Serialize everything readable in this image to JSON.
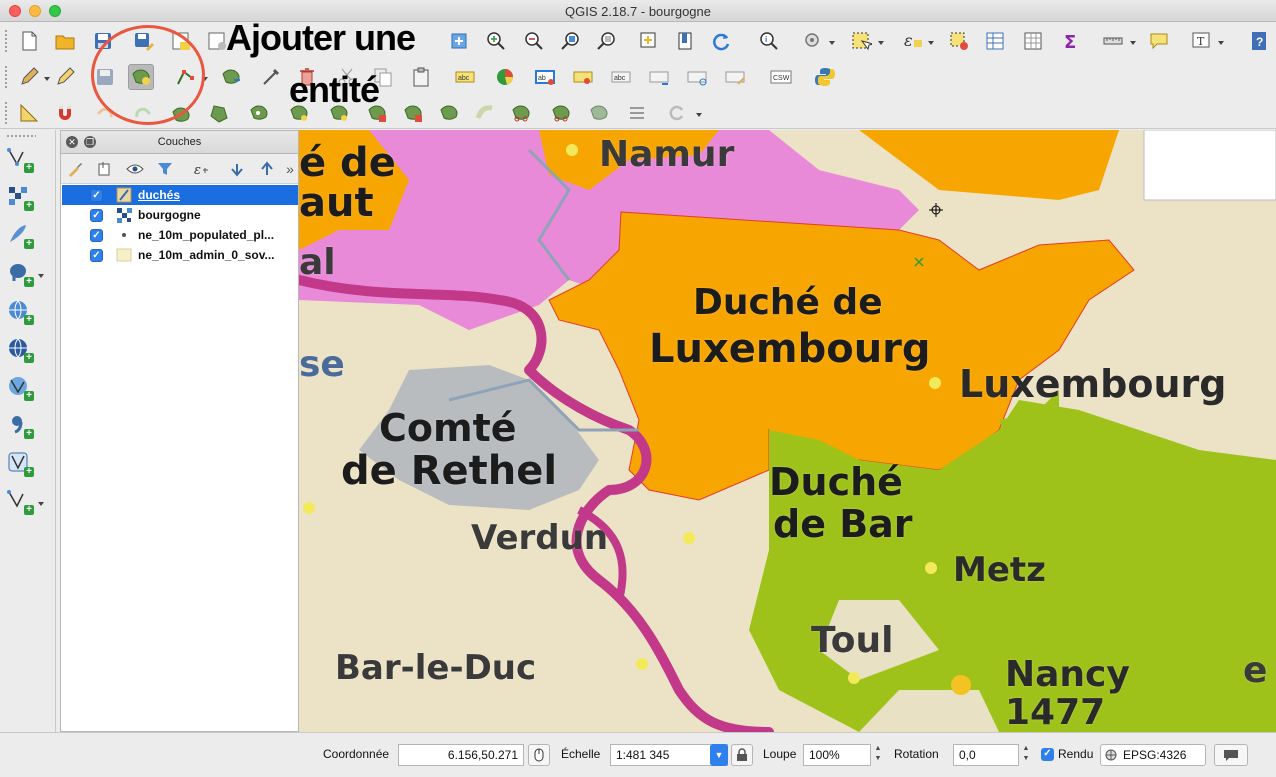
{
  "window": {
    "title": "QGIS 2.18.7 - bourgogne"
  },
  "annotation": {
    "line1": "Ajouter une",
    "line2": "entité"
  },
  "layers_panel": {
    "title": "Couches",
    "layers": [
      {
        "name": "duchés",
        "checked": true,
        "selected": true,
        "icon": "line-layer-icon"
      },
      {
        "name": "bourgogne",
        "checked": true,
        "selected": false,
        "icon": "raster-layer-icon"
      },
      {
        "name": "ne_10m_populated_pl...",
        "checked": true,
        "selected": false,
        "icon": "point-layer-icon"
      },
      {
        "name": "ne_10m_admin_0_sov...",
        "checked": true,
        "selected": false,
        "icon": "polygon-layer-icon"
      }
    ]
  },
  "map": {
    "labels": {
      "namur": "Namur",
      "de": "é de",
      "aut": "aut",
      "al": "al",
      "se": "se",
      "luxembourg_duche_1": "Duché de",
      "luxembourg_duche_2": "Luxembourg",
      "luxembourg_city": "Luxembourg",
      "rethel_1": "Comté",
      "rethel_2": "de Rethel",
      "bar_1": "Duché",
      "bar_2": "de Bar",
      "verdun": "Verdun",
      "metz": "Metz",
      "toul": "Toul",
      "bar_le_duc": "Bar-le-Duc",
      "nancy": "Nancy",
      "year": "1477",
      "e": "e"
    },
    "colors": {
      "background": "#ece3c6",
      "luxembourg": "#f7a500",
      "pink": "#e98ad8",
      "green": "#9fc21a",
      "gray": "#b8bcbf",
      "border": "#c2398a"
    }
  },
  "status": {
    "coord_label": "Coordonnée",
    "coord_value": "6.156,50.271",
    "scale_label": "Échelle",
    "scale_value": "1:481 345",
    "loupe_label": "Loupe",
    "loupe_value": "100%",
    "rotation_label": "Rotation",
    "rotation_value": "0,0",
    "render_label": "Rendu",
    "crs_value": "EPSG:4326"
  }
}
